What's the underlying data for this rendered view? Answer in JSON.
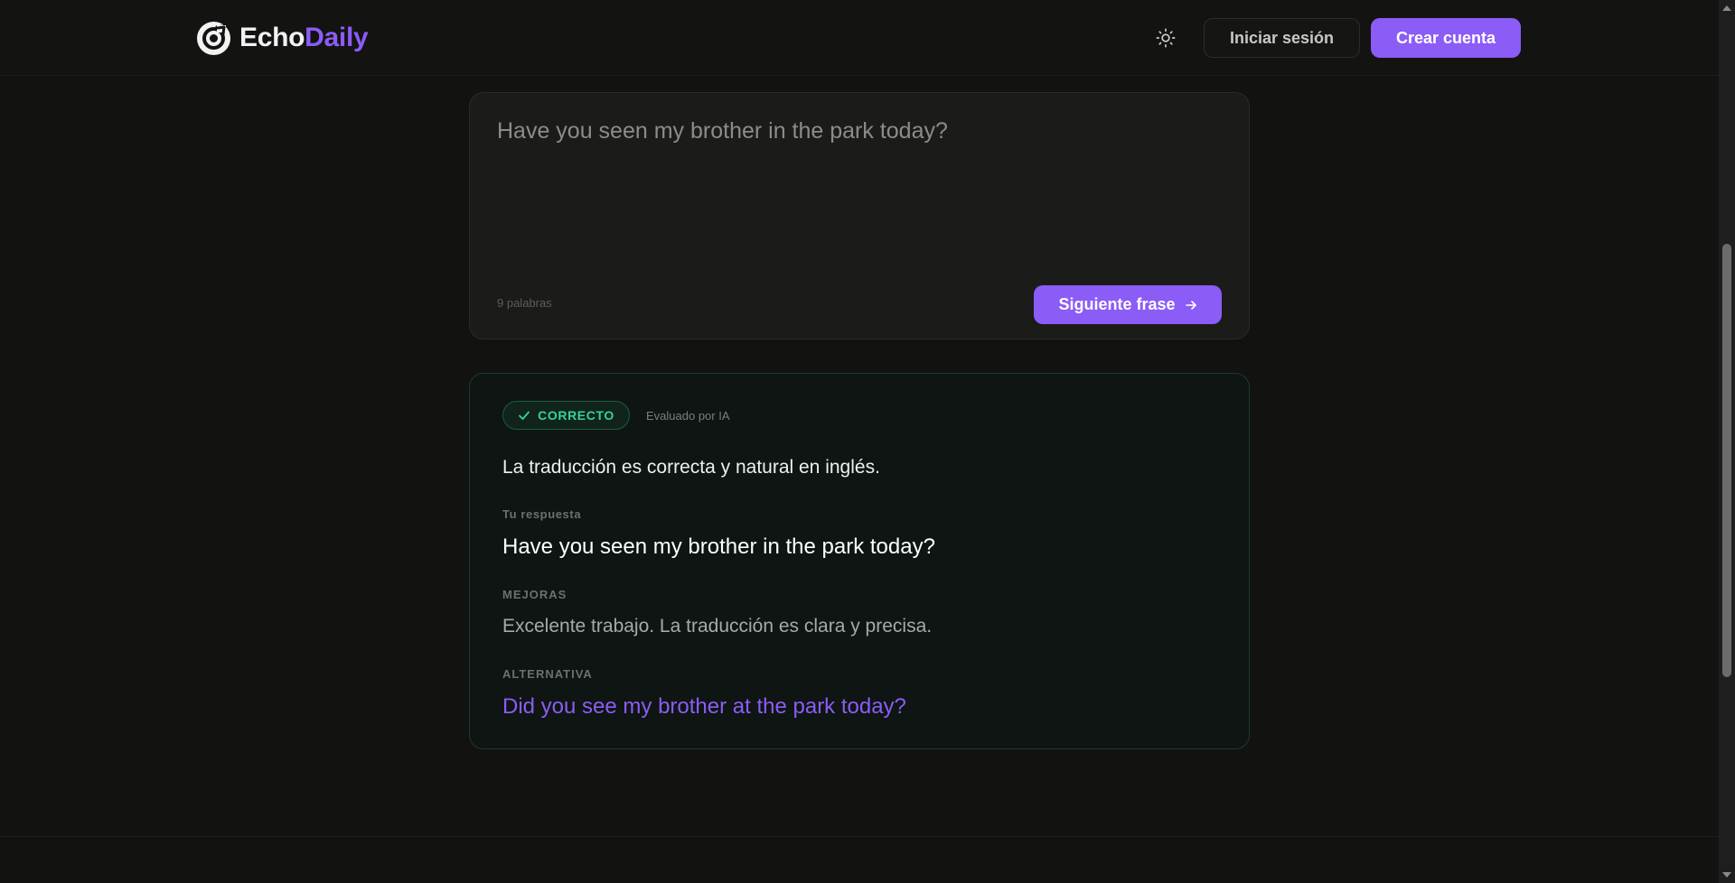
{
  "header": {
    "brand_part1": "Echo",
    "brand_part2": "Daily",
    "theme_toggle_icon": "sun-icon",
    "login_label": "Iniciar sesión",
    "signup_label": "Crear cuenta"
  },
  "input_card": {
    "text": "Have you seen my brother in the park today?",
    "word_count": "9 palabras",
    "next_label": "Siguiente frase",
    "next_icon": "arrow-right-icon"
  },
  "feedback": {
    "badge_label": "CORRECTO",
    "badge_icon": "check-icon",
    "evaluated_by": "Evaluado por IA",
    "summary": "La traducción es correcta y natural en inglés.",
    "answer_label": "Tu respuesta",
    "answer": "Have you seen my brother in the park today?",
    "improvements_label": "MEJORAS",
    "improvements": "Excelente trabajo. La traducción es clara y precisa.",
    "alternative_label": "ALTERNATIVA",
    "alternative": "Did you see my brother at the park today?"
  },
  "colors": {
    "accent": "#8b5cf6",
    "success": "#34d399",
    "background": "#121211"
  }
}
